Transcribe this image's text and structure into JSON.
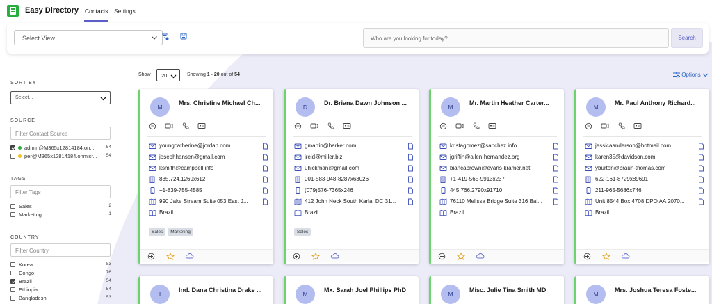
{
  "app": {
    "title": "Easy Directory",
    "logo_icon": "directory-logo-icon",
    "accent": "#27ae3e"
  },
  "nav": {
    "tabs": [
      {
        "label": "Contacts",
        "active": true
      },
      {
        "label": "Settings",
        "active": false
      }
    ]
  },
  "filterbar": {
    "select_view_label": "Select View",
    "search_placeholder": "Who are you looking for today?",
    "search_button": "Search",
    "icons": [
      "filter-clear-icon",
      "save-view-icon"
    ]
  },
  "sidebar": {
    "sort_by": {
      "title": "SORT BY",
      "value": "Select..."
    },
    "source": {
      "title": "SOURCE",
      "placeholder": "Filter Contact Source",
      "items": [
        {
          "label": "admin@M365x12814184.on...",
          "count": "54",
          "checked": true,
          "dot_color": "#27ae3e"
        },
        {
          "label": "per@M365x12814184.onmicr...",
          "count": "54",
          "checked": false,
          "dot_color": "#f0c419"
        }
      ]
    },
    "tags": {
      "title": "TAGS",
      "placeholder": "Filter Tags",
      "items": [
        {
          "label": "Sales",
          "count": "2",
          "checked": false
        },
        {
          "label": "Marketing",
          "count": "1",
          "checked": false
        }
      ]
    },
    "country": {
      "title": "COUNTRY",
      "placeholder": "Filter Country",
      "items": [
        {
          "label": "Korea",
          "count": "83",
          "checked": false
        },
        {
          "label": "Congo",
          "count": "76",
          "checked": false
        },
        {
          "label": "Brazil",
          "count": "54",
          "checked": true
        },
        {
          "label": "Ethiopia",
          "count": "54",
          "checked": false
        },
        {
          "label": "Bangladesh",
          "count": "53",
          "checked": false
        }
      ]
    }
  },
  "results": {
    "show_label": "Show",
    "page_size": "20",
    "showing_prefix": "Showing ",
    "range": "1 - 20",
    "out_of": " out of ",
    "total": "54",
    "options_label": "Options"
  },
  "cards": [
    {
      "initial": "M",
      "name": "Mrs. Christine Michael Ch...",
      "email1": "youngcatherine@jordan.com",
      "email2": "josephhansen@gmail.com",
      "email3": "ksmith@campbell.info",
      "phone1": "835.724.1269x612",
      "phone2": "+1-839-755-4585",
      "address": "990 Jake Stream Suite 053 East J...",
      "country": "Brazil",
      "tags": [
        "Sales",
        "Marketing"
      ]
    },
    {
      "initial": "D",
      "name": "Dr. Briana Dawn Johnson ...",
      "email1": "gmartin@barker.com",
      "email2": "jreid@miller.biz",
      "email3": "uhickman@gmail.com",
      "phone1": "001-583-948-8287x63026",
      "phone2": "(079)576-7365x246",
      "address": "412 John Neck South Karla, DC 31...",
      "country": "Brazil",
      "tags": [
        "Sales"
      ]
    },
    {
      "initial": "M",
      "name": "Mr. Martin Heather Carter...",
      "email1": "kristagomez@sanchez.info",
      "email2": "jgriffin@allen-hernandez.org",
      "email3": "biancabrown@evans-kramer.net",
      "phone1": "+1-419-565-9913x237",
      "phone2": "445.766.2790x91710",
      "address": "76110 Melissa Bridge Suite 316 Bal...",
      "country": "Brazil",
      "tags": []
    },
    {
      "initial": "M",
      "name": "Mr. Paul Anthony Richard...",
      "email1": "jessicaanderson@hotmail.com",
      "email2": "karen35@davidson.com",
      "email3": "yburton@braun-thomas.com",
      "phone1": "622-161-8729x89691",
      "phone2": "211-965-5686x746",
      "address": "Unit 8544 Box 4708 DPO AA 2070...",
      "country": "Brazil",
      "tags": []
    }
  ],
  "cards_row2": [
    {
      "initial": "I",
      "name": "Ind. Dana Christina Drake ..."
    },
    {
      "initial": "M",
      "name": "Mx. Sarah Joel Phillips PhD"
    },
    {
      "initial": "M",
      "name": "Misc. Julie Tina Smith MD"
    },
    {
      "initial": "M",
      "name": "Mrs. Joshua Teresa Foste..."
    }
  ]
}
